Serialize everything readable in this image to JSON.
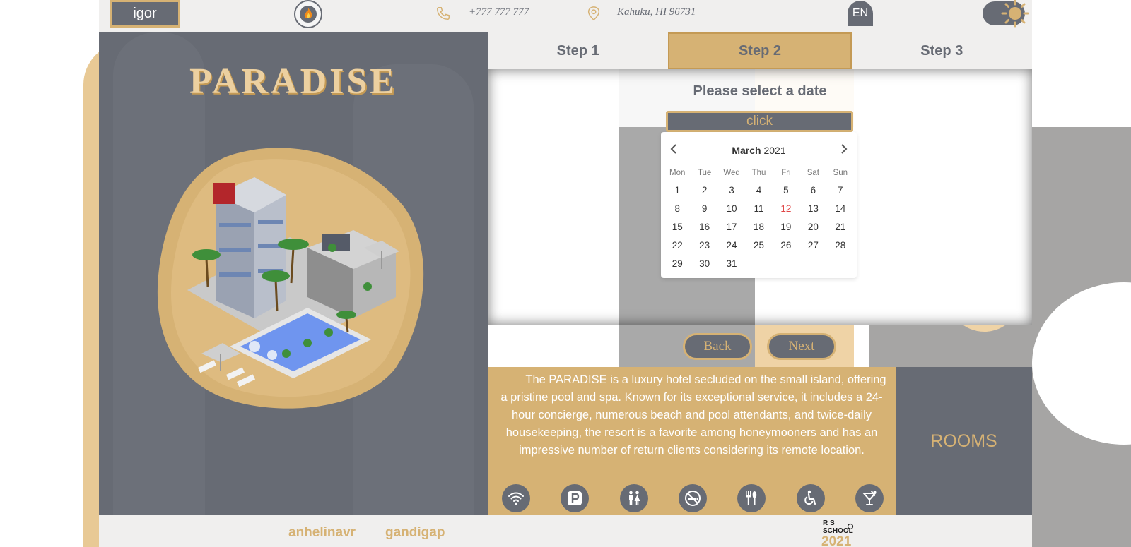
{
  "header": {
    "user_name": "igor",
    "phone": "+777 777 777",
    "address": "Kahuku, HI 96731",
    "language": "EN"
  },
  "hero": {
    "brand": "PARADISE"
  },
  "stepper": {
    "steps": [
      "Step 1",
      "Step 2",
      "Step 3"
    ],
    "active_index": 1
  },
  "form": {
    "prompt": "Please select a date",
    "date_input_value": "click"
  },
  "calendar": {
    "month": "March",
    "year": "2021",
    "weekdays": [
      "Mon",
      "Tue",
      "Wed",
      "Thu",
      "Fri",
      "Sat",
      "Sun"
    ],
    "days": [
      1,
      2,
      3,
      4,
      5,
      6,
      7,
      8,
      9,
      10,
      11,
      12,
      13,
      14,
      15,
      16,
      17,
      18,
      19,
      20,
      21,
      22,
      23,
      24,
      25,
      26,
      27,
      28,
      29,
      30,
      31
    ],
    "highlighted_day": 12
  },
  "nav": {
    "back_label": "Back",
    "next_label": "Next"
  },
  "description": "The PARADISE is a luxury hotel secluded on the small island, offering a pristine pool and spa. Known for its exceptional service, it includes a 24-hour concierge, numerous beach and pool attendants, and twice-daily housekeeping, the resort is a favorite among honeymooners and has an impressive number of return clients considering its remote location.",
  "amenities": [
    "wifi-icon",
    "parking-icon",
    "restroom-icon",
    "no-smoking-icon",
    "restaurant-icon",
    "wheelchair-icon",
    "cocktail-icon"
  ],
  "rooms_label": "ROOMS",
  "footer": {
    "authors": [
      "anhelinavr",
      "gandigap"
    ],
    "school_logo_text": "RS SCHOOL",
    "school_year": "2021"
  },
  "colors": {
    "slate": "#676b74",
    "gold": "#d6b274",
    "light": "#f0efee",
    "today": "#e04545"
  }
}
